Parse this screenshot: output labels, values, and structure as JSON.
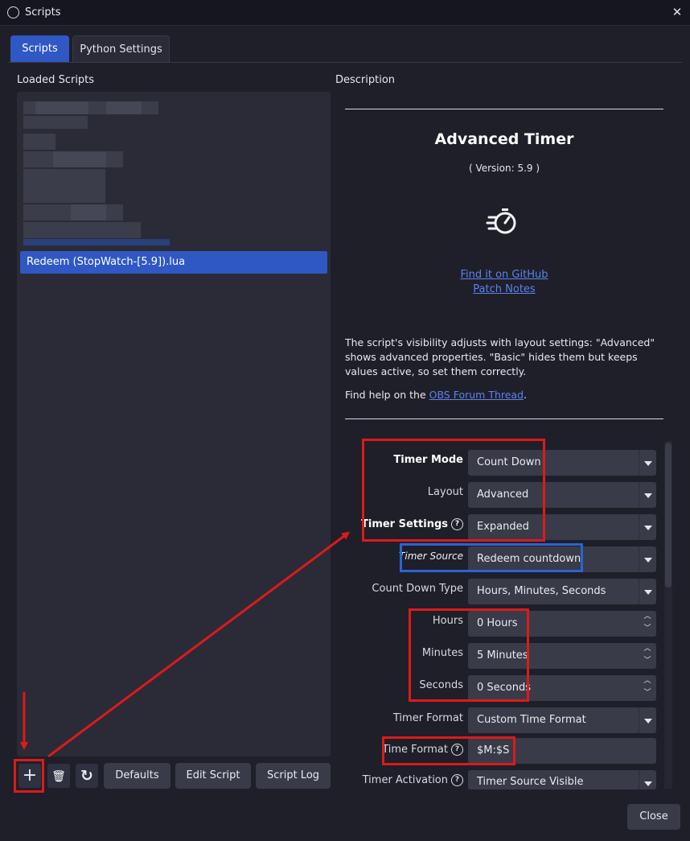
{
  "window": {
    "title": "Scripts",
    "close_glyph": "✕",
    "icon": "obs-logo-icon"
  },
  "tabs": [
    {
      "label": "Scripts",
      "active": true
    },
    {
      "label": "Python Settings",
      "active": false
    }
  ],
  "left": {
    "heading": "Loaded Scripts",
    "selected_script": "Redeem (StopWatch-[5.9]).lua",
    "buttons": {
      "add": "+",
      "remove": "🗑",
      "reload": "↻",
      "defaults": "Defaults",
      "edit_script": "Edit Script",
      "script_log": "Script Log"
    }
  },
  "description": {
    "heading": "Description",
    "title": "Advanced Timer",
    "version": "( Version: 5.9 )",
    "icon": "stopwatch-icon",
    "link_github": "Find it on GitHub",
    "link_patch_notes": "Patch Notes",
    "paragraph": "The script's visibility adjusts with layout settings: \"Advanced\" shows advanced properties. \"Basic\" hides them but keeps values active, so set them correctly.",
    "help_prefix": "Find help on the ",
    "help_link": "OBS Forum Thread",
    "help_suffix": "."
  },
  "form": {
    "timer_mode": {
      "label": "Timer Mode",
      "value": "Count Down"
    },
    "layout": {
      "label": "Layout",
      "value": "Advanced"
    },
    "timer_settings": {
      "label": "Timer Settings",
      "value": "Expanded"
    },
    "timer_source": {
      "label": "Timer Source",
      "value": "Redeem countdown"
    },
    "count_down_type": {
      "label": "Count Down Type",
      "value": "Hours, Minutes, Seconds"
    },
    "hours": {
      "label": "Hours",
      "value": "0 Hours"
    },
    "minutes": {
      "label": "Minutes",
      "value": "5 Minutes"
    },
    "seconds": {
      "label": "Seconds",
      "value": "0 Seconds"
    },
    "timer_format": {
      "label": "Timer Format",
      "value": "Custom Time Format"
    },
    "time_format": {
      "label": "Time Format",
      "value": "$M:$S"
    },
    "timer_activation": {
      "label": "Timer Activation",
      "value": "Timer Source Visible"
    }
  },
  "footer": {
    "close_label": "Close"
  },
  "colors": {
    "accent": "#2f58c4",
    "annotation_red": "#dd1a1a",
    "annotation_blue": "#2a64d4",
    "link": "#5a84f0"
  }
}
